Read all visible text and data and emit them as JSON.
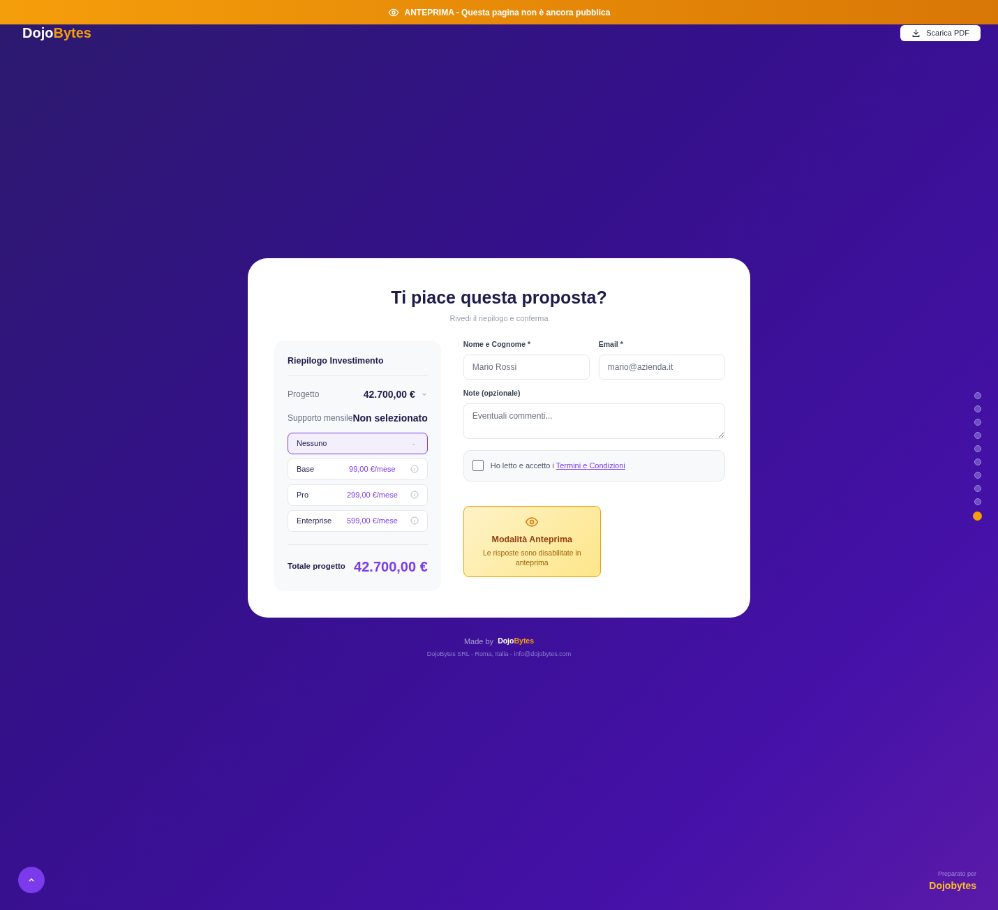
{
  "banner": {
    "label": "ANTEPRIMA",
    "text": "- Questa pagina non è ancora pubblica"
  },
  "header": {
    "logo": [
      "Dojo",
      "Bytes"
    ],
    "download_button": "Scarica PDF"
  },
  "card": {
    "title": "Ti piace questa proposta?",
    "subtitle": "Rivedi il riepilogo e conferma",
    "summary": {
      "title": "Riepilogo Investimento",
      "rows": [
        {
          "label": "Progetto",
          "value": "42.700,00 €",
          "expandable": true
        },
        {
          "label": "Supporto mensile",
          "value": "Non selezionato",
          "expandable": false
        }
      ],
      "plans": [
        {
          "name": "Nessuno",
          "price": "-",
          "selected": true
        },
        {
          "name": "Base",
          "price": "99,00 €/mese",
          "selected": false
        },
        {
          "name": "Pro",
          "price": "299,00 €/mese",
          "selected": false
        },
        {
          "name": "Enterprise",
          "price": "599,00 €/mese",
          "selected": false
        }
      ],
      "total_label": "Totale progetto",
      "total": "42.700,00 €"
    },
    "form": {
      "name": {
        "label": "Nome e Cognome *",
        "placeholder": "Mario Rossi"
      },
      "email": {
        "label": "Email *",
        "placeholder": "mario@azienda.it"
      },
      "notes": {
        "label": "Note (opzionale)",
        "placeholder": "Eventuali commenti..."
      },
      "terms": {
        "text": "Ho letto e accetto i",
        "link": "Termini e Condizioni",
        "checked": false
      },
      "preview_notice": {
        "title": "Modalità Anteprima",
        "text": "Le risposte sono disabilitate in anteprima"
      }
    }
  },
  "footer": {
    "made_by": "Made by",
    "logo": [
      "Dojo",
      "Bytes"
    ],
    "address": "DojoBytes SRL - Roma, Italia - info@dojobytes.com"
  },
  "section_dots": [
    {
      "selected": false
    },
    {
      "selected": false
    },
    {
      "selected": false
    },
    {
      "selected": false
    },
    {
      "selected": false
    },
    {
      "selected": false
    },
    {
      "selected": false
    },
    {
      "selected": false
    },
    {
      "selected": false
    },
    {
      "selected": true
    }
  ],
  "prepared_for": {
    "label": "Preparato per",
    "name": "Dojobytes"
  }
}
